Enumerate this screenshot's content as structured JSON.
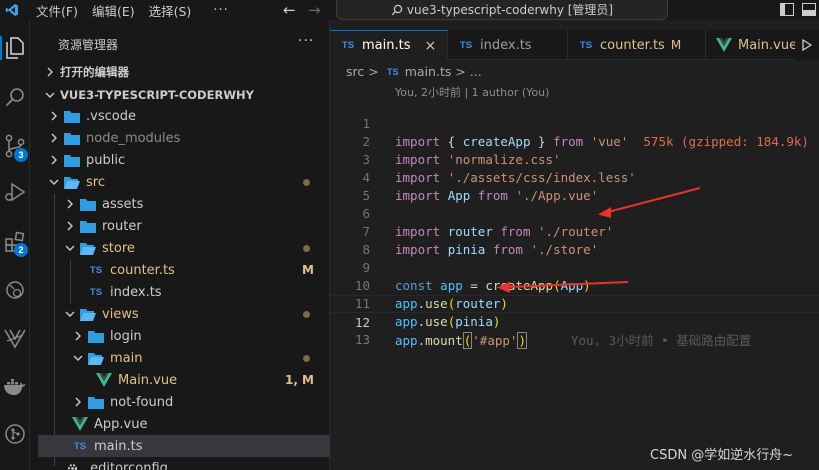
{
  "titlebar": {
    "menus": [
      "文件(F)",
      "编辑(E)",
      "选择(S)"
    ],
    "more": "···",
    "search_text": "vue3-typescript-coderwhy [管理员]"
  },
  "activity": {
    "scm_badge": "3",
    "extensions_badge": "2"
  },
  "sidebar": {
    "title": "资源管理器",
    "more": "···",
    "open_editors": "打开的编辑器",
    "project": "VUE3-TYPESCRIPT-CODERWHY",
    "tree": [
      {
        "name": ".vscode",
        "kind": "folder"
      },
      {
        "name": "node_modules",
        "kind": "folder"
      },
      {
        "name": "public",
        "kind": "folder"
      },
      {
        "name": "src",
        "kind": "folder-open"
      },
      {
        "name": "assets",
        "kind": "folder"
      },
      {
        "name": "router",
        "kind": "folder"
      },
      {
        "name": "store",
        "kind": "folder-open"
      },
      {
        "name": "counter.ts",
        "kind": "ts",
        "status": "M"
      },
      {
        "name": "index.ts",
        "kind": "ts"
      },
      {
        "name": "views",
        "kind": "folder-open"
      },
      {
        "name": "login",
        "kind": "folder"
      },
      {
        "name": "main",
        "kind": "folder-open"
      },
      {
        "name": "Main.vue",
        "kind": "vue",
        "status": "1, M"
      },
      {
        "name": "not-found",
        "kind": "folder"
      },
      {
        "name": "App.vue",
        "kind": "vue"
      },
      {
        "name": "main.ts",
        "kind": "ts"
      },
      {
        "name": ".editorconfig",
        "kind": "config"
      }
    ]
  },
  "tabs": [
    {
      "label": "main.ts",
      "icon": "TS",
      "close": "×"
    },
    {
      "label": "index.ts",
      "icon": "TS"
    },
    {
      "label": "counter.ts",
      "icon": "TS",
      "status": "M"
    },
    {
      "label": "Main.vue",
      "icon": "vue"
    }
  ],
  "breadcrumb": {
    "folder": "src",
    "sep": ">",
    "file": "main.ts",
    "tail": "> ..."
  },
  "blame_header": "You, 2小时前 | 1 author (You)",
  "code": {
    "line_numbers": [
      "1",
      "2",
      "3",
      "4",
      "5",
      "6",
      "7",
      "8",
      "9",
      "10",
      "11",
      "12",
      "13"
    ],
    "l1": {
      "kw1": "import",
      "b1": " { ",
      "fn": "createApp",
      "b2": " } ",
      "kw2": "from",
      "str": "'vue'",
      "hint": "575k (gzipped: 184.9k)"
    },
    "l2": {
      "kw": "import",
      "str": "'normalize.css'"
    },
    "l3": {
      "kw": "import",
      "str": "'./assets/css/index.less'"
    },
    "l4": {
      "kw1": "import",
      "var": "App",
      "kw2": "from",
      "str": "'./App.vue'"
    },
    "l6": {
      "kw1": "import",
      "var": "router",
      "kw2": "from",
      "str": "'./router'"
    },
    "l7": {
      "kw1": "import",
      "var": "pinia",
      "kw2": "from",
      "str": "'./store'"
    },
    "l9": {
      "kw": "const",
      "var": "app",
      "op": " = ",
      "fn": "createApp",
      "arg": "App"
    },
    "l10": {
      "obj": "app",
      "fn": "use",
      "arg": "router"
    },
    "l11": {
      "obj": "app",
      "fn": "use",
      "arg": "pinia"
    },
    "l12": {
      "obj": "app",
      "fn": "mount",
      "str": "'#app'",
      "blame": "You, 3小时前 • 基础路由配置"
    }
  },
  "watermark": "CSDN @学如逆水行舟~",
  "colors": {
    "accent": "#0078d4",
    "annotation_arrow": "#e8322c"
  }
}
